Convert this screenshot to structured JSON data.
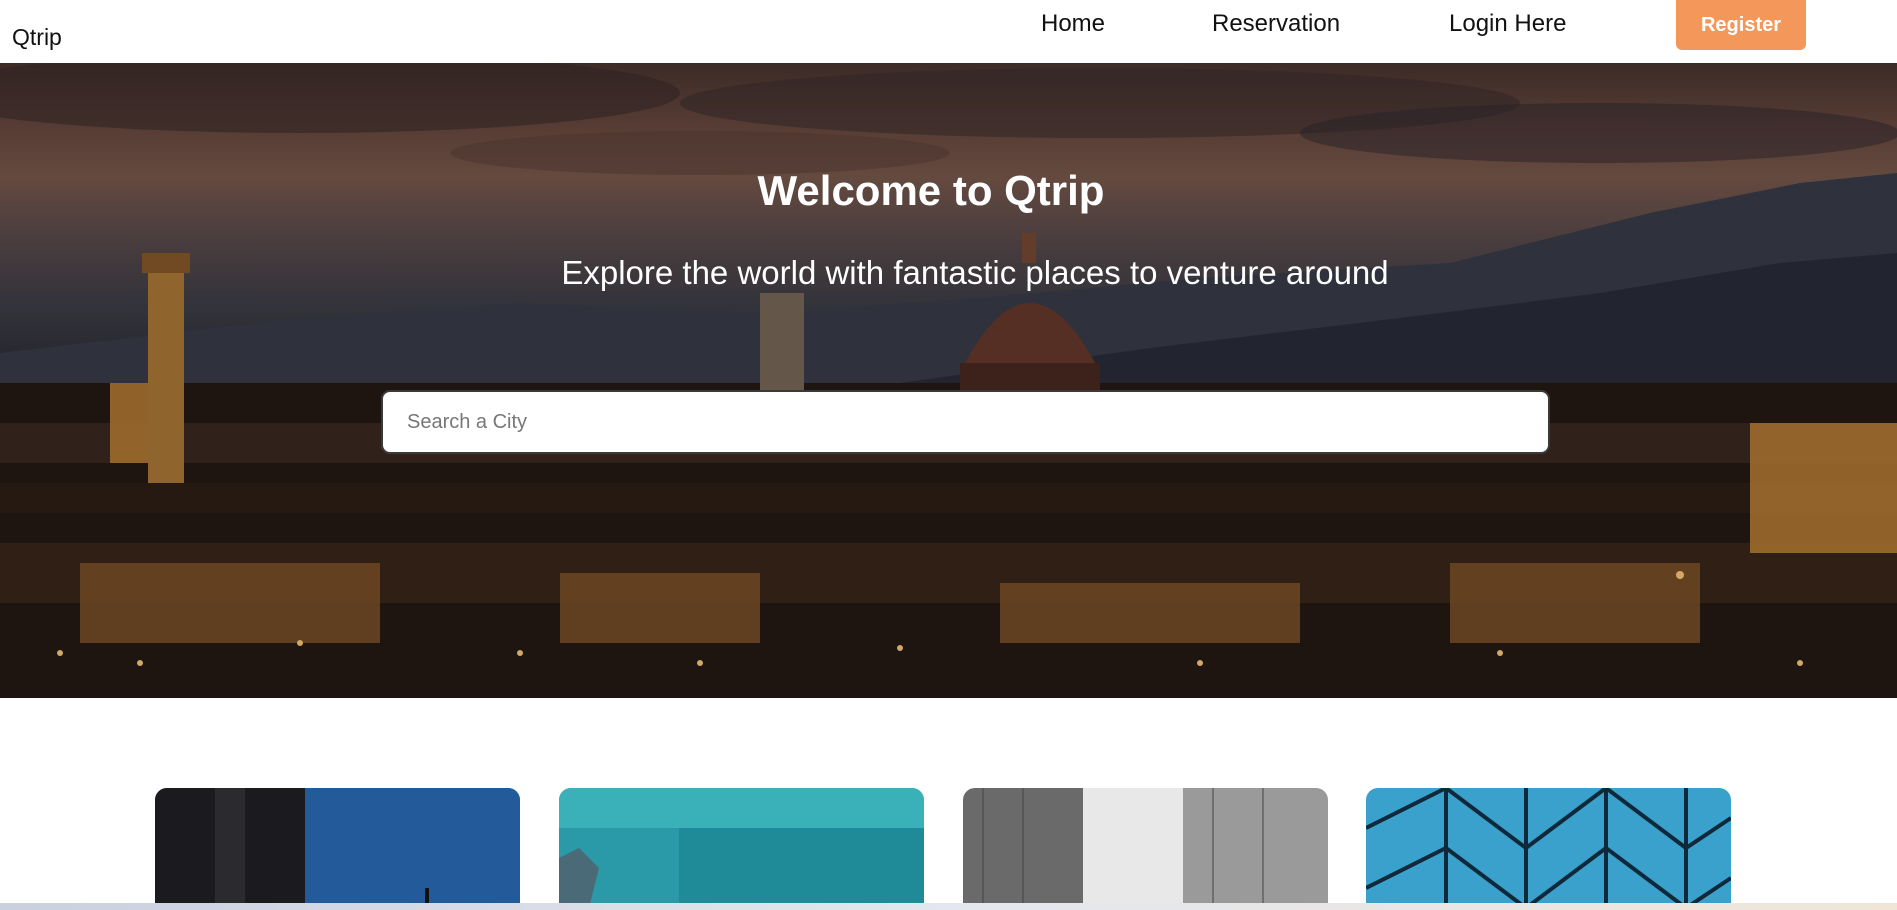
{
  "navbar": {
    "brand": "Qtrip",
    "links": [
      {
        "label": "Home"
      },
      {
        "label": "Reservation"
      },
      {
        "label": "Login Here"
      }
    ],
    "register_label": "Register",
    "register_color": "#f4975a"
  },
  "hero": {
    "title": "Welcome to Qtrip",
    "subtitle": "Explore the world with fantastic places to venture around",
    "search_placeholder": "Search a City"
  },
  "cards": [
    {
      "image": "city-tower-blue-sky"
    },
    {
      "image": "turquoise-sea-coast"
    },
    {
      "image": "glass-skyscrapers"
    },
    {
      "image": "geometric-glass-dome"
    }
  ]
}
